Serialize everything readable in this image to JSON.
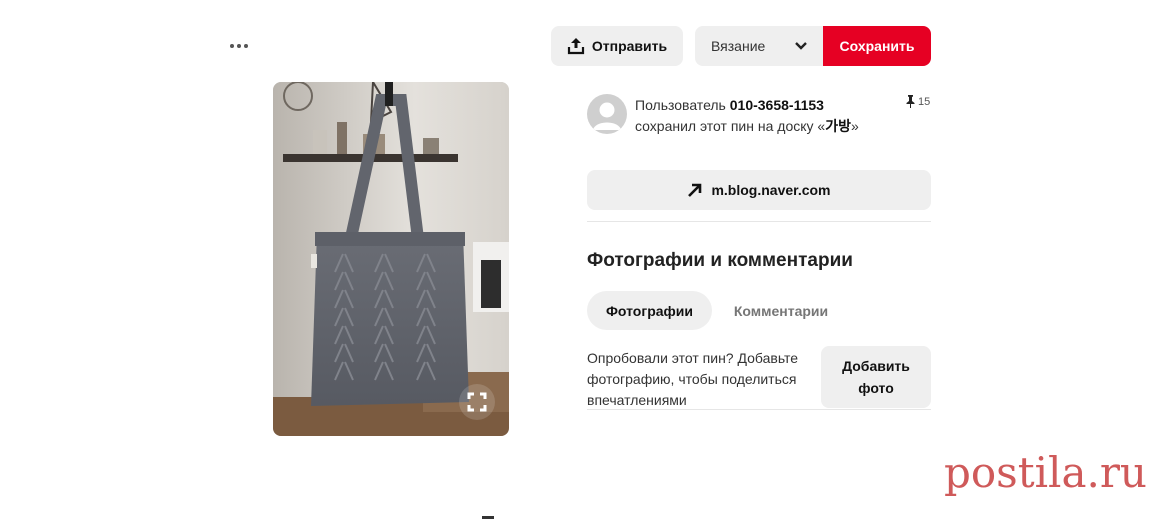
{
  "header": {
    "more_icon": "ellipsis-icon",
    "share_label": "Отправить",
    "share_icon": "upload-icon",
    "board_selected": "Вязание",
    "board_icon": "chevron-down-icon",
    "save_label": "Сохранить",
    "save_color": "#e60023"
  },
  "pin": {
    "image_subject": "knitted-gray-tote-bag",
    "expand_icon": "expand-icon"
  },
  "saver": {
    "prefix": "Пользователь",
    "name": "010-3658-1153",
    "action": "сохранил этот пин на доску «",
    "board": "가방",
    "suffix": "»",
    "saves_count": "15",
    "saves_icon": "pin-icon"
  },
  "link": {
    "label": "m.blog.naver.com",
    "icon": "arrow-up-right-icon"
  },
  "photos_section": {
    "title": "Фотографии и комментарии",
    "tabs": [
      "Фотографии",
      "Комментарии"
    ],
    "active_tab": "Фотографии",
    "prompt": "Опробовали этот пин? Добавьте фотографию, чтобы поделиться впечатлениями",
    "add_photo_label": "Добавить фото"
  },
  "watermark": "postila.ru"
}
